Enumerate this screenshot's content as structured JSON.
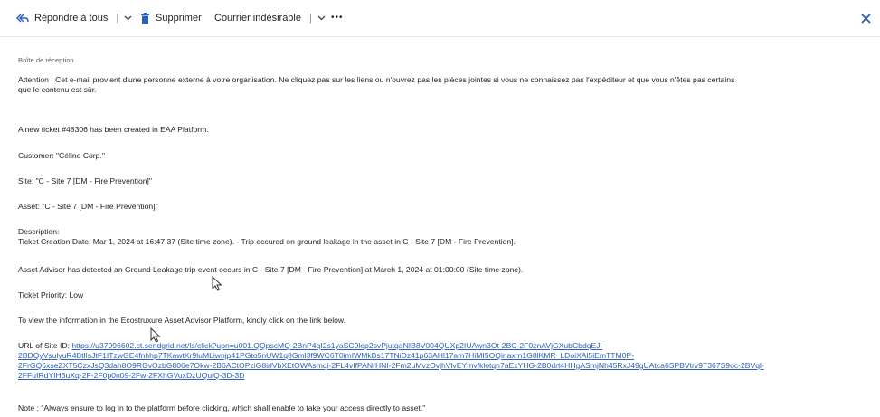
{
  "toolbar": {
    "reply_all_label": "Répondre à tous",
    "delete_label": "Supprimer",
    "junk_label": "Courrier indésirable",
    "more_label": "•••",
    "separator": "|"
  },
  "email": {
    "folder": "Boîte de réception",
    "warning": "Attention : Cet e-mail provient d'une personne externe à votre organisation. Ne cliquez pas sur les liens ou n'ouvrez pas les pièces jointes si vous ne connaissez pas l'expéditeur et que vous n'êtes pas certains",
    "warning_line2": "que le contenu est sûr.",
    "line_ticket": "A new ticket #48306 has been created in EAA Platform.",
    "line_customer": "Customer: \"Céline Corp.\"",
    "line_site": "Site: \"C - Site 7 [DM - Fire Prevention]\"",
    "line_asset": "Asset: \"C - Site 7 [DM - Fire Prevention]\"",
    "desc_label": "Description:",
    "desc_text": "Ticket Creation Date: Mar  1, 2024 at 16:47:37 (Site time zone). - Trip occured on ground leakage in the asset in C - Site 7 [DM - Fire Prevention].",
    "advisor_text": "Asset Advisor has detected an Ground Leakage trip event occurs in C - Site 7 [DM - Fire Prevention] at March  1, 2024 at 01:00:00 (Site time zone).",
    "priority": "Ticket Priority:  Low",
    "view_info": "To view the information in the Ecostruxure Asset Advisor Platform, kindly click on the link below.",
    "url_label": "URL of Site ID: ",
    "url_line1": "https://u37996602.ct.sendgrid.net/ls/click?upn=u001.QQpscMQ-2BnP4qI2s1yaSC9lep2svPjutqaNIB8V004QUXp2IUAwn3Ot-2BC-2F0znAVjGXubCbdqEJ-",
    "url_line2": "2BDQyVsulyuR4BtlIsJtF1ITzwGE4fnhhp7TKawtKr9luMLiwnjp41PGto5nUW1q8Gml3f9WC6T0imIWMkBs17TNiDz41p63AHl17am7HiMI5OQinaxrn1G8lKMR_LDoiXAl5iEmTTM0P-",
    "url_line3": "2FrGQ6xseZXT5CzxJsQ3dah8O9RGvOzbG806e7Okw-2B6ACtOPziG8irlVbXEtOWAsmqi-2FL4vIfPANrHNI-2Fm2uMvzOvjhVlvEYmvfklotqn7aExYHG-2B0drt4HHgASmjNh45RxJ49gUAtca6SPBVtrv9T367S9oc-2BVql-",
    "url_line4": "2FFuIRdYIH3uXq-2F-2F0p0n09-2Fw-2FXhGVuxDzUQuiQ-3D-3D",
    "note": "Note : \"Always ensure to log in to the platform before clicking, which shall enable to take your access directly to asset.\""
  },
  "icons": {
    "reply_all": "reply-all-icon",
    "delete": "trash-icon",
    "chevron": "chevron-down-icon",
    "close": "close-icon",
    "cursor": "mouse-cursor-icon"
  },
  "colors": {
    "accent": "#2b5fb8",
    "text": "#242424",
    "muted": "#616161"
  }
}
